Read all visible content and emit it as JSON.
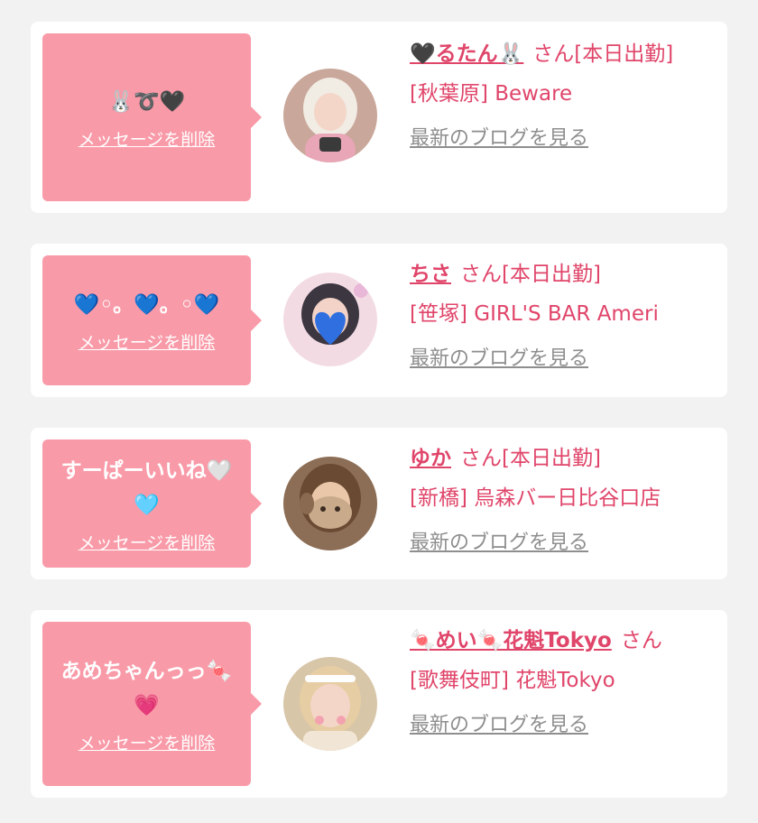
{
  "messages": [
    {
      "message": "🐰➰🖤",
      "delete_label": "メッセージを削除",
      "name": "🖤るたん🐰",
      "san_suffix": "さん[本日出勤]",
      "location": "[秋葉原] Beware",
      "blog_label": "最新のブログを見る",
      "avatar_colors": {
        "bg": "#c9a79a",
        "hair": "#f1ece4",
        "face": "#f4d6c8",
        "outfit": "#e8a6b6"
      }
    },
    {
      "message": "💙◦。💙。◦💙",
      "delete_label": "メッセージを削除",
      "name": "ちさ",
      "san_suffix": "さん[本日出勤]",
      "location": "[笹塚] GIRL'S BAR Ameri",
      "blog_label": "最新のブログを見る",
      "avatar_colors": {
        "bg": "#f3dbe4",
        "hair": "#3b3640",
        "face": "#f3d2c7",
        "outfit": "#2f6fe0"
      }
    },
    {
      "message": "すーぱーいいね🤍🩵",
      "delete_label": "メッセージを削除",
      "name": "ゆか",
      "san_suffix": "さん[本日出勤]",
      "location": "[新橋] 烏森バー日比谷口店",
      "blog_label": "最新のブログを見る",
      "avatar_colors": {
        "bg": "#8c6d55",
        "hair": "#6b4a33",
        "face": "#e9c7a8",
        "outfit": "#c9ab8c"
      }
    },
    {
      "message": "あめちゃんっっ🍬💗",
      "delete_label": "メッセージを削除",
      "name": "🍬めい🍬花魁Tokyo",
      "san_suffix": "さん",
      "location": "[歌舞伎町] 花魁Tokyo",
      "blog_label": "最新のブログを見る",
      "avatar_colors": {
        "bg": "#d8c6a8",
        "hair": "#e6cda3",
        "face": "#f4d6c8",
        "outfit": "#f1e6d6"
      }
    }
  ],
  "icons": [
    "avatar"
  ],
  "colors": {
    "accent": "#e0456a",
    "bubble": "#f99aa8",
    "link_gray": "#8e8e8e",
    "bg": "#f2f2f2"
  }
}
